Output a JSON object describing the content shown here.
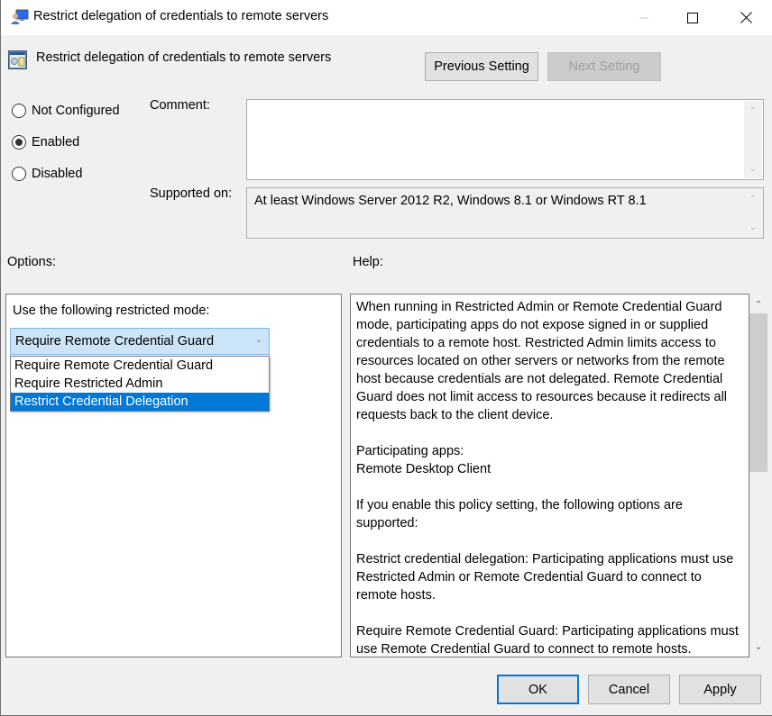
{
  "window": {
    "title": "Restrict delegation of credentials to remote servers",
    "controls": {
      "minimize": "minimize-icon",
      "maximize": "maximize-icon",
      "close": "close-icon"
    }
  },
  "header": {
    "title": "Restrict delegation of credentials to remote servers",
    "previous_label": "Previous Setting",
    "next_label": "Next Setting",
    "next_disabled": true
  },
  "state": {
    "options": [
      {
        "label": "Not Configured",
        "checked": false
      },
      {
        "label": "Enabled",
        "checked": true
      },
      {
        "label": "Disabled",
        "checked": false
      }
    ]
  },
  "comment": {
    "label": "Comment:",
    "value": ""
  },
  "supported": {
    "label": "Supported on:",
    "value": "At least Windows Server 2012 R2, Windows 8.1 or Windows RT 8.1"
  },
  "options_section": {
    "label": "Options:",
    "mode_label": "Use the following restricted mode:",
    "combo_value": "Require Remote Credential Guard",
    "dropdown_items": [
      {
        "label": "Require Remote Credential Guard",
        "selected": false
      },
      {
        "label": "Require Restricted Admin",
        "selected": false
      },
      {
        "label": "Restrict Credential Delegation",
        "selected": true
      }
    ]
  },
  "help_section": {
    "label": "Help:",
    "text": "When running in Restricted Admin or Remote Credential Guard mode, participating apps do not expose signed in or supplied credentials to a remote host. Restricted Admin limits access to resources located on other servers or networks from the remote host because credentials are not delegated. Remote Credential Guard does not limit access to resources because it redirects all requests back to the client device.\n\nParticipating apps:\nRemote Desktop Client\n\nIf you enable this policy setting, the following options are supported:\n\nRestrict credential delegation: Participating applications must use Restricted Admin or Remote Credential Guard to connect to remote hosts.\n\nRequire Remote Credential Guard: Participating applications must use Remote Credential Guard to connect to remote hosts."
  },
  "footer": {
    "ok_label": "OK",
    "cancel_label": "Cancel",
    "apply_label": "Apply"
  },
  "colors": {
    "accent": "#0078d7",
    "combo_bg": "#cce4f7",
    "dialog_bg": "#f0f0f0"
  }
}
